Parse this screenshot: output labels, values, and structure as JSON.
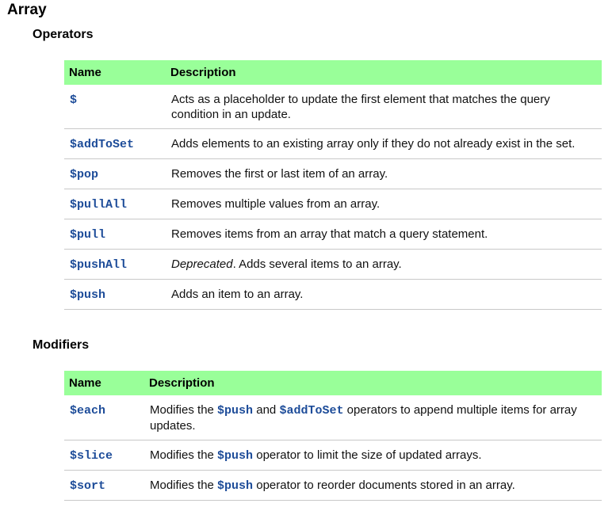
{
  "page": {
    "title": "Array"
  },
  "operators": {
    "heading": "Operators",
    "columns": [
      "Name",
      "Description"
    ],
    "rows": [
      {
        "name": "$",
        "description": "Acts as a placeholder to update the first element that matches the query condition in an update."
      },
      {
        "name": "$addToSet",
        "description": "Adds elements to an existing array only if they do not already exist in the set."
      },
      {
        "name": "$pop",
        "description": "Removes the first or last item of an array."
      },
      {
        "name": "$pullAll",
        "description": "Removes multiple values from an array."
      },
      {
        "name": "$pull",
        "description": "Removes items from an array that match a query statement."
      },
      {
        "name": "$pushAll",
        "description_em": "Deprecated",
        "description": ". Adds several items to an array."
      },
      {
        "name": "$push",
        "description": "Adds an item to an array."
      }
    ]
  },
  "modifiers": {
    "heading": "Modifiers",
    "columns": [
      "Name",
      "Description"
    ],
    "rows": [
      {
        "name": "$each",
        "parts": [
          "Modifies the ",
          "$push",
          " and ",
          "$addToSet",
          " operators to append multiple items for array updates."
        ]
      },
      {
        "name": "$slice",
        "parts": [
          "Modifies the ",
          "$push",
          " operator to limit the size of updated arrays."
        ]
      },
      {
        "name": "$sort",
        "parts": [
          "Modifies the ",
          "$push",
          " operator to reorder documents stored in an array."
        ]
      }
    ]
  }
}
